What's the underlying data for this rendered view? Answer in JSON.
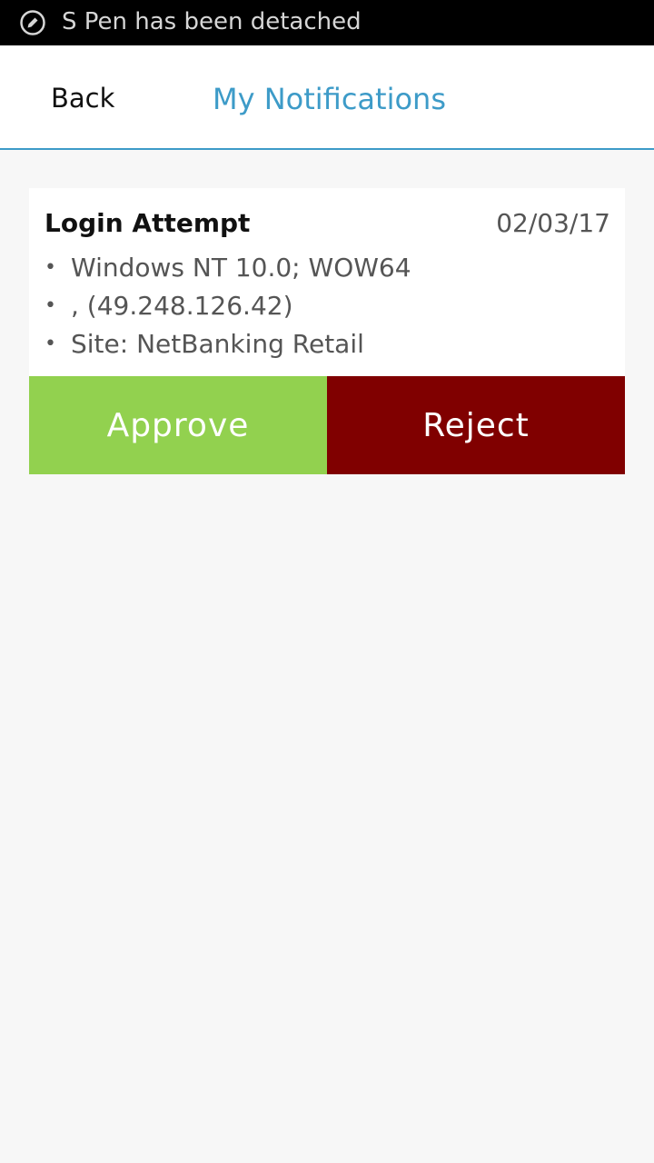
{
  "status_bar": {
    "icon": "pen-icon",
    "text": "S Pen has been detached"
  },
  "header": {
    "back_label": "Back",
    "title": "My Notifications"
  },
  "notification": {
    "title": "Login Attempt",
    "date": "02/03/17",
    "details": [
      "Windows NT 10.0; WOW64",
      ",  (49.248.126.42)",
      "Site: NetBanking Retail"
    ],
    "approve_label": "Approve",
    "reject_label": "Reject"
  },
  "colors": {
    "accent": "#3d9bc8",
    "approve": "#92d14f",
    "reject": "#800000",
    "background": "#f7f7f7"
  }
}
